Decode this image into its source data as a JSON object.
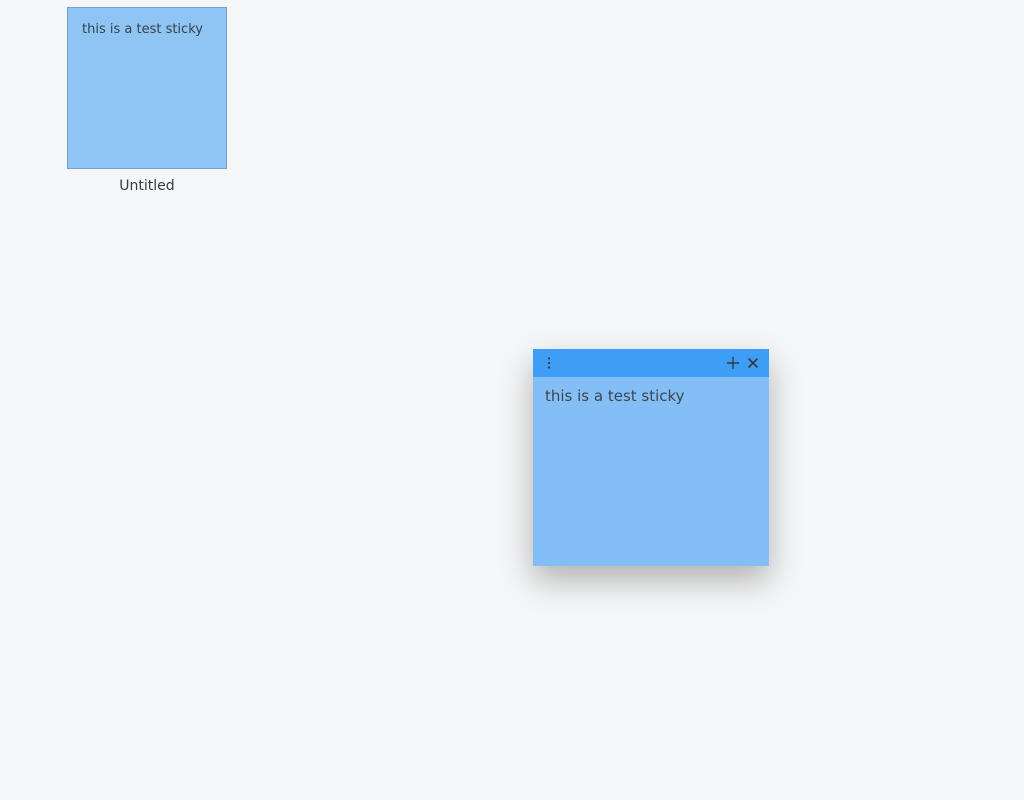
{
  "thumbnail": {
    "content": "this is a test sticky",
    "label": "Untitled"
  },
  "note": {
    "content": "this is a test sticky"
  },
  "icons": {
    "menu": "menu-icon",
    "add": "plus-icon",
    "close": "close-icon"
  },
  "colors": {
    "note_body": "#84bef6",
    "note_titlebar": "#3e9ef5",
    "thumb": "#8ec5f5",
    "desktop": "#f5f6f7"
  }
}
